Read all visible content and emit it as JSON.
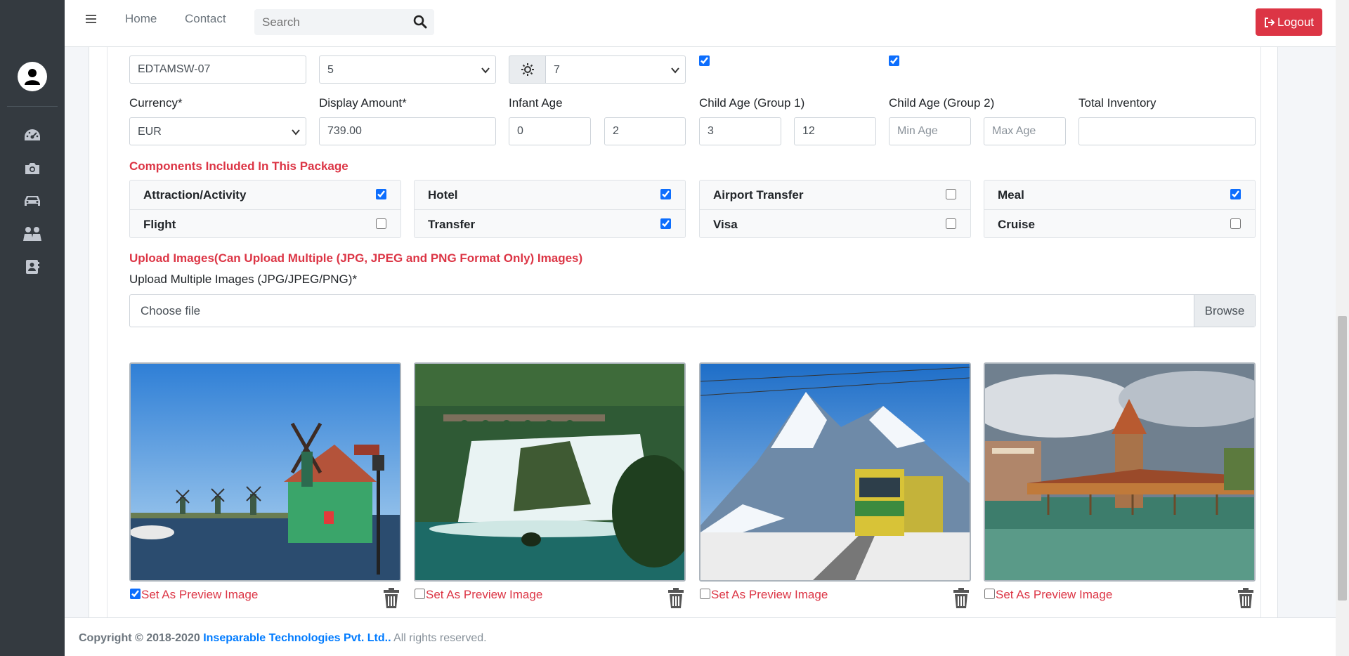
{
  "navbar": {
    "links": [
      "Home",
      "Contact"
    ],
    "search_placeholder": "Search",
    "logout_label": "Logout"
  },
  "sidebar": {
    "icons": [
      "dashboard-icon",
      "camera-icon",
      "car-icon",
      "users-icon",
      "contacts-icon"
    ]
  },
  "form": {
    "package_code": "EDTAMSW-07",
    "nights_value": "5",
    "days_value": "7",
    "currency_label": "Currency*",
    "currency_value": "EUR",
    "display_amount_label": "Display Amount*",
    "display_amount_value": "739.00",
    "infant_age_label": "Infant Age",
    "infant_min": "0",
    "infant_max": "2",
    "child1_label": "Child Age (Group 1)",
    "child1_min": "3",
    "child1_max": "12",
    "child2_label": "Child Age (Group 2)",
    "child2_min_placeholder": "Min Age",
    "child2_max_placeholder": "Max Age",
    "total_inventory_label": "Total Inventory",
    "total_inventory_value": ""
  },
  "components": {
    "heading": "Components Included In This Package",
    "items": [
      {
        "label": "Attraction/Activity",
        "checked": true
      },
      {
        "label": "Flight",
        "checked": false
      },
      {
        "label": "Hotel",
        "checked": true
      },
      {
        "label": "Transfer",
        "checked": true
      },
      {
        "label": "Airport Transfer",
        "checked": false
      },
      {
        "label": "Visa",
        "checked": false
      },
      {
        "label": "Meal",
        "checked": true
      },
      {
        "label": "Cruise",
        "checked": false
      }
    ]
  },
  "upload": {
    "heading": "Upload Images(Can Upload Multiple (JPG, JPEG and PNG Format Only) Images)",
    "field_label": "Upload Multiple Images (JPG/JPEG/PNG)*",
    "choose_text": "Choose file",
    "browse_label": "Browse"
  },
  "images": [
    {
      "scene": "windmills-by-canal",
      "preview": true
    },
    {
      "scene": "waterfall",
      "preview": false
    },
    {
      "scene": "mountain-train",
      "preview": false
    },
    {
      "scene": "covered-bridge-tower",
      "preview": false
    }
  ],
  "preview_label": "Set As Preview Image",
  "footer": {
    "copyright": "Copyright © 2018-2020",
    "company": "Inseparable Technologies Pvt. Ltd..",
    "rights": "All rights reserved."
  }
}
